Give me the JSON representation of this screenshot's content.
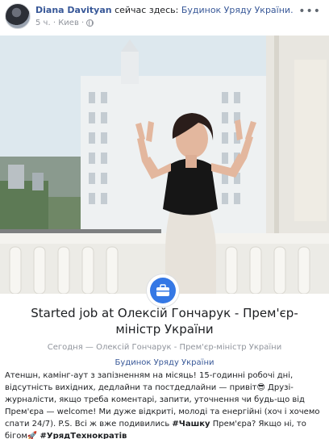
{
  "header": {
    "author": "Diana Davityan",
    "checkin_text": "сейчас здесь:",
    "place": "Будинок Уряду України.",
    "time": "5 ч.",
    "location": "Киев",
    "separator": "·",
    "more_icon": "more-horizontal-icon",
    "privacy_icon": "globe-icon"
  },
  "life_event": {
    "title": "Started job at Олексій Гончарук - Прем'єр-міністр України",
    "subtitle": "Сегодня — Олексій Гончарук - Прем'єр-міністр України",
    "place": "Будинок Уряду України",
    "icon": "briefcase-icon"
  },
  "caption": {
    "text": "Атеншн, камінг-аут з запізненням на місяць! 15-годинні робочі дні, відсутність вихідних, дедлайни та постдедлайни — привіт😎 Друзі-журналісти, якщо треба коментарі, запити, уточнення чи будь-що від Прем'єра — welcome! Ми дуже відкриті, молоді та енергійні (хоч і хочемо спати 24/7). P.S. Всі ж вже подивились ",
    "hashtag1": "#Чашку",
    "text2": " Прем'єра? Якщо ні, то бігом🚀 ",
    "hashtag2": "#УрядТехнократів"
  },
  "colors": {
    "link": "#385898",
    "muted": "#90949c",
    "badge": "#3578e5"
  }
}
